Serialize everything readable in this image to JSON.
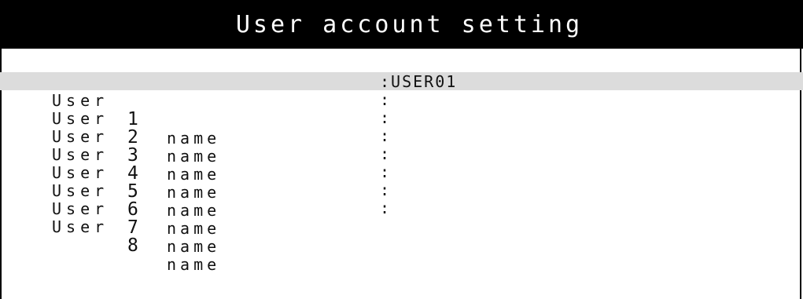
{
  "window": {
    "title": "User account setting"
  },
  "users": [
    {
      "word": "User",
      "number": "1",
      "suffix": "name",
      "value": ":USER01",
      "selected": true
    },
    {
      "word": "User",
      "number": "2",
      "suffix": "name",
      "value": ":",
      "selected": false
    },
    {
      "word": "User",
      "number": "3",
      "suffix": "name",
      "value": ":",
      "selected": false
    },
    {
      "word": "User",
      "number": "4",
      "suffix": "name",
      "value": ":",
      "selected": false
    },
    {
      "word": "User",
      "number": "5",
      "suffix": "name",
      "value": ":",
      "selected": false
    },
    {
      "word": "User",
      "number": "6",
      "suffix": "name",
      "value": ":",
      "selected": false
    },
    {
      "word": "User",
      "number": "7",
      "suffix": "name",
      "value": ":",
      "selected": false
    },
    {
      "word": "User",
      "number": "8",
      "suffix": "name",
      "value": ":",
      "selected": false
    }
  ],
  "colors": {
    "title_bg": "#000000",
    "title_fg": "#ffffff",
    "selected_row_bg": "#dcdcdc",
    "text": "#111111"
  }
}
